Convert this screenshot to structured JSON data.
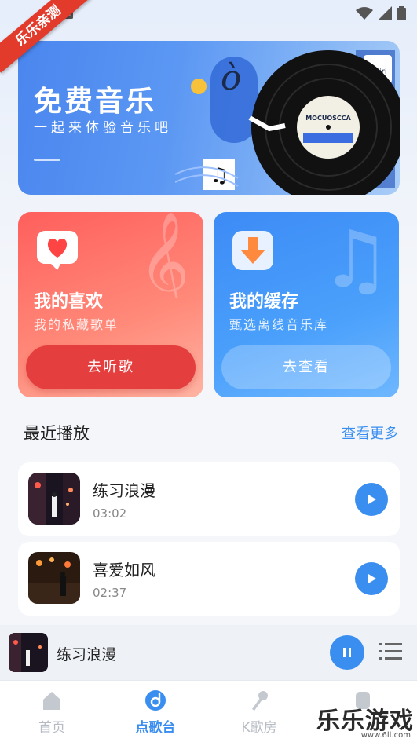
{
  "ribbon": {
    "text": "乐乐亲测"
  },
  "banner": {
    "title": "免费音乐",
    "subtitle": "一起来体验音乐吧",
    "record_label": "MOCUOSCCA"
  },
  "cards": {
    "favorites": {
      "title": "我的喜欢",
      "subtitle": "我的私藏歌单",
      "button": "去听歌"
    },
    "cache": {
      "title": "我的缓存",
      "subtitle": "甄选离线音乐库",
      "button": "去查看"
    }
  },
  "recent": {
    "title": "最近播放",
    "more": "查看更多",
    "songs": [
      {
        "name": "练习浪漫",
        "duration": "03:02"
      },
      {
        "name": "喜爱如风",
        "duration": "02:37"
      }
    ]
  },
  "mini_player": {
    "song": "练习浪漫",
    "state": "playing"
  },
  "nav": {
    "items": [
      {
        "label": "首页",
        "icon": "home-icon"
      },
      {
        "label": "点歌台",
        "icon": "music-disc-icon",
        "active": true
      },
      {
        "label": "K歌房",
        "icon": "microphone-icon"
      },
      {
        "label": "",
        "icon": "profile-icon"
      }
    ]
  },
  "watermark": {
    "text": "乐乐游戏",
    "url": "www.6ll.com"
  },
  "colors": {
    "accent": "#3a8ef0",
    "red": "#e53e3e"
  }
}
